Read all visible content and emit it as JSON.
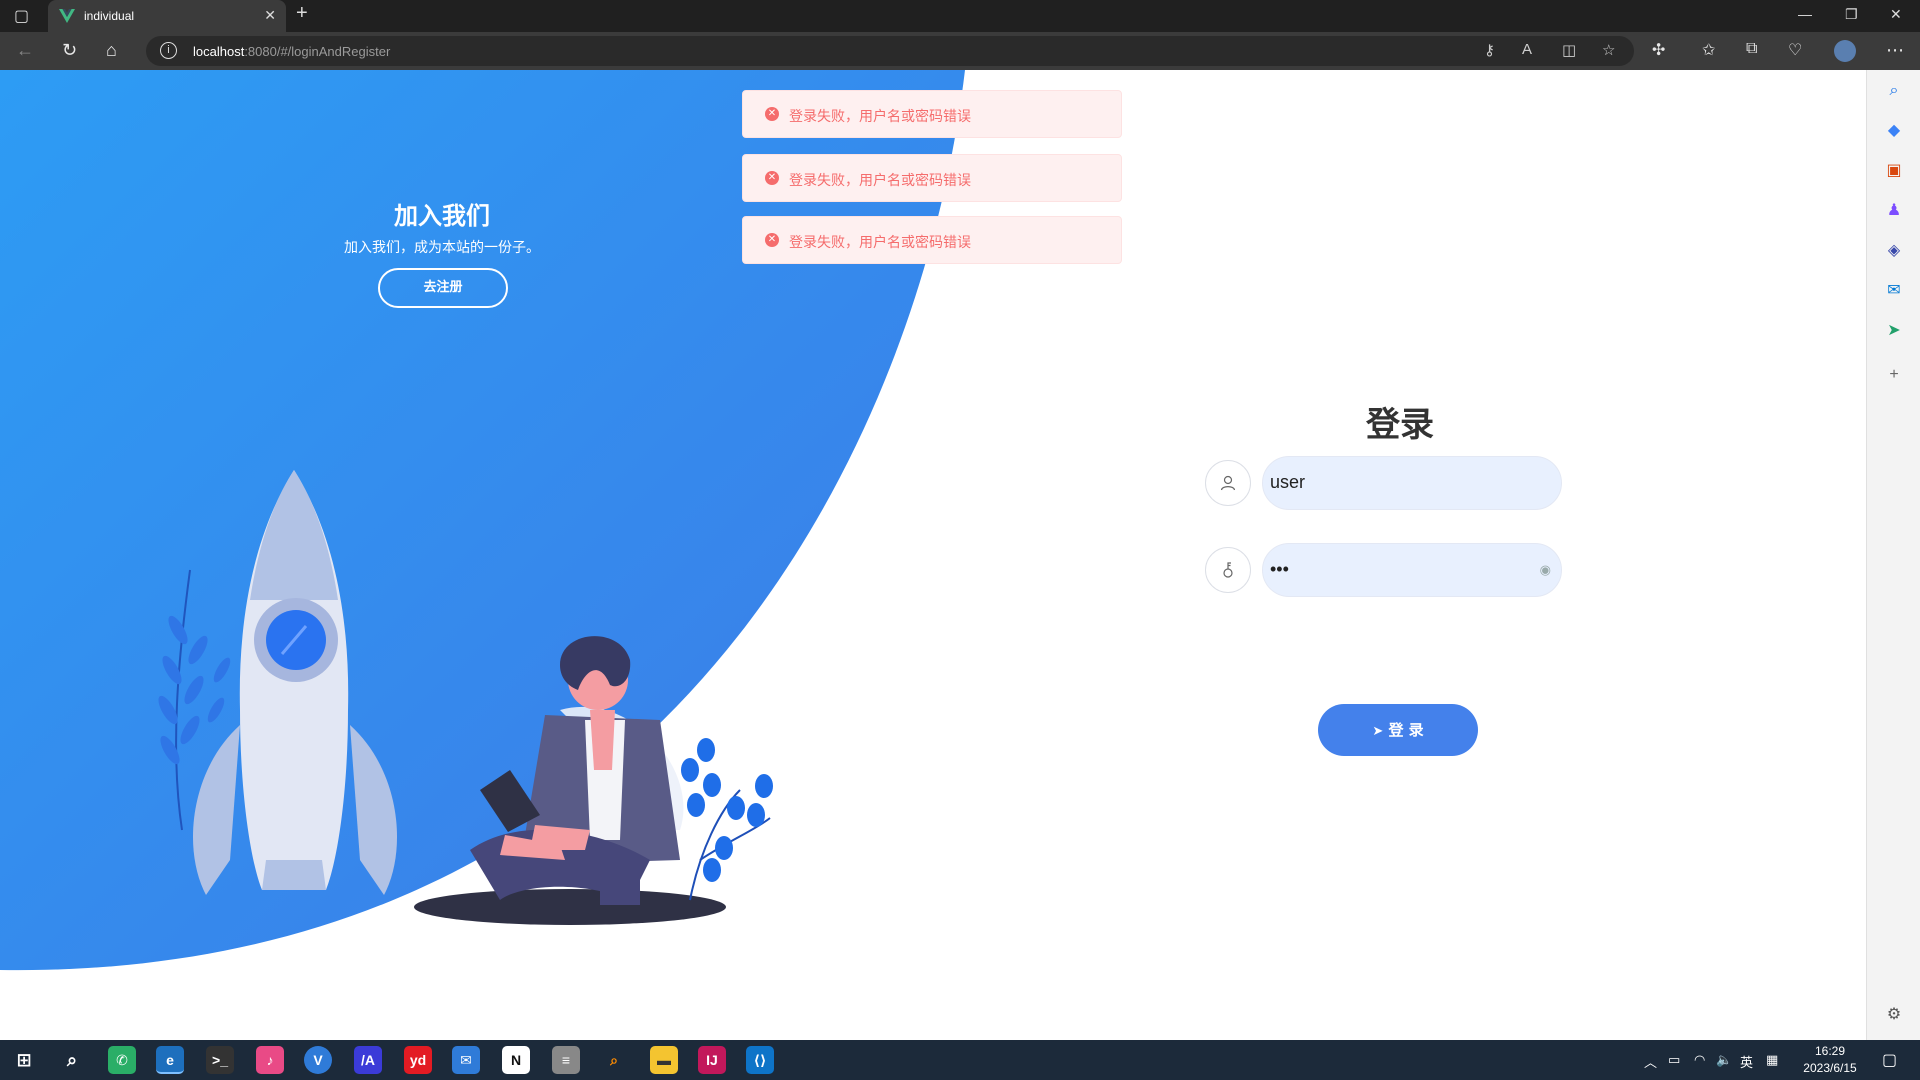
{
  "browser": {
    "tab_title": "individual",
    "url_host": "localhost",
    "url_rest": ":8080/#/loginAndRegister",
    "new_tab": "+"
  },
  "panel": {
    "title": "加入我们",
    "subtitle": "加入我们，成为本站的一份子。",
    "register_button": "去注册"
  },
  "notifications": [
    {
      "type": "error",
      "message": "登录失败，用户名或密码错误"
    },
    {
      "type": "error",
      "message": "登录失败，用户名或密码错误"
    },
    {
      "type": "error",
      "message": "登录失败，用户名或密码错误"
    }
  ],
  "login": {
    "title": "登录",
    "username_value": "user",
    "password_value": "•••",
    "submit_label": "登 录"
  },
  "taskbar": {
    "ime": "英",
    "time": "16:29",
    "date": "2023/6/15"
  },
  "colors": {
    "brand_blue": "#4481eb",
    "gradient_start": "#2d9cf4",
    "error": "#f56c6c",
    "error_bg": "#fef0f0"
  }
}
